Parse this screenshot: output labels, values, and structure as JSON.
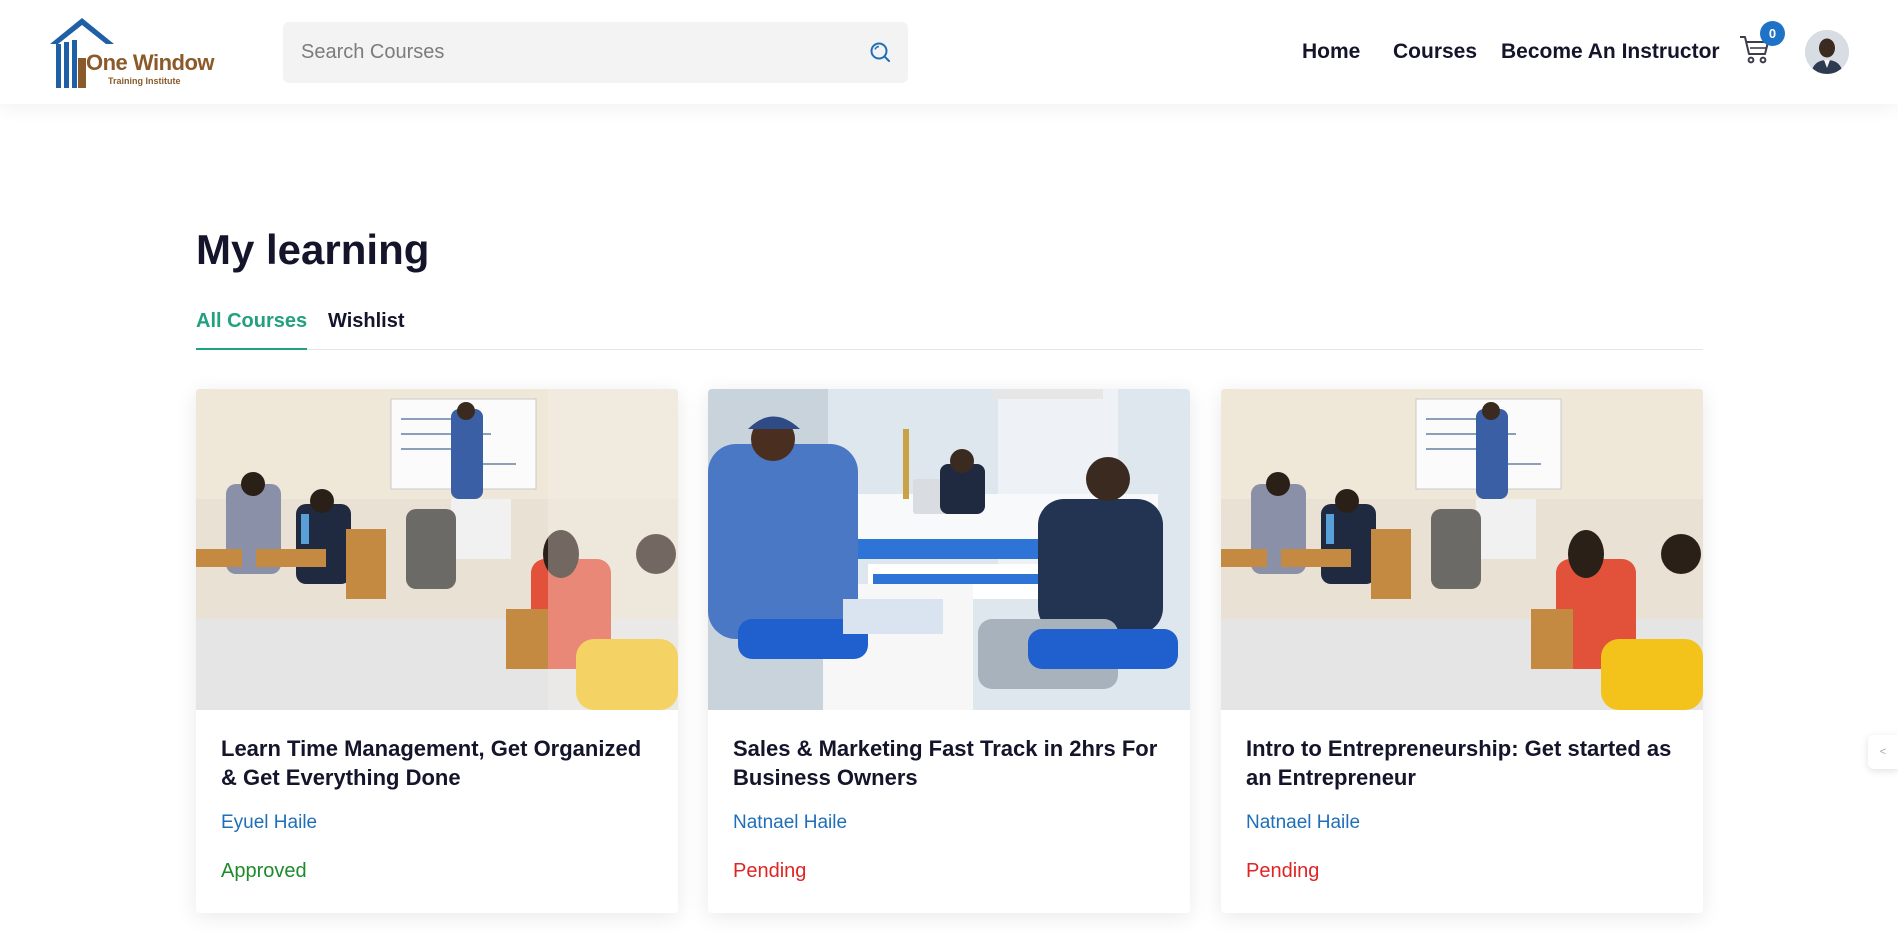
{
  "header": {
    "logo": {
      "text": "One Window",
      "subtitle": "Training Institute"
    },
    "search": {
      "placeholder": "Search Courses",
      "value": ""
    },
    "nav": [
      {
        "label": "Home"
      },
      {
        "label": "Courses"
      },
      {
        "label": "Become An Instructor"
      }
    ],
    "cart": {
      "count": "0",
      "icon": "cart-icon"
    },
    "avatar": {
      "icon": "user-avatar"
    }
  },
  "page": {
    "title": "My learning",
    "tabs": [
      {
        "label": "All Courses",
        "active": true
      },
      {
        "label": "Wishlist",
        "active": false
      }
    ]
  },
  "courses": [
    {
      "title": "Learn Time Management, Get Organized & Get Everything Done",
      "instructor": "Eyuel Haile",
      "status": "Approved",
      "status_color": "#1e8a2b"
    },
    {
      "title": "Sales & Marketing Fast Track in 2hrs For Business Owners",
      "instructor": "Natnael Haile",
      "status": "Pending",
      "status_color": "#e02424"
    },
    {
      "title": "Intro to Entrepreneurship: Get started as an Entrepreneur",
      "instructor": "Natnael Haile",
      "status": "Pending",
      "status_color": "#e02424"
    }
  ],
  "colors": {
    "accent": "#22a07f",
    "link": "#1f6fb8",
    "badge": "#1f73c6"
  }
}
